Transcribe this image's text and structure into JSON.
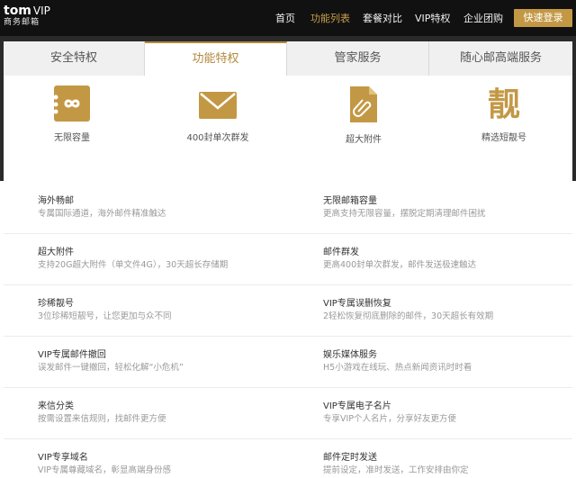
{
  "brand": {
    "name": "tom",
    "vip": "VIP",
    "subtitle": "商务邮箱"
  },
  "nav": {
    "items": [
      "首页",
      "功能列表",
      "套餐对比",
      "VIP特权",
      "企业团购"
    ],
    "active_index": 1,
    "login_label": "快速登录"
  },
  "tabs": [
    "安全特权",
    "功能特权",
    "管家服务",
    "随心邮高端服务"
  ],
  "active_tab": 1,
  "features": [
    {
      "label": "无限容量",
      "icon": "infinity-icon"
    },
    {
      "label": "400封单次群发",
      "icon": "envelope-icon"
    },
    {
      "label": "超大附件",
      "icon": "paperclip-icon"
    },
    {
      "label": "精选短靓号",
      "icon": "liang-character-icon"
    }
  ],
  "rows": [
    {
      "left": {
        "title": "海外畅邮",
        "desc": "专属国际通道，海外邮件精准触达"
      },
      "right": {
        "title": "无限邮箱容量",
        "desc": "更高支持无限容量，摆脱定期清理邮件困扰"
      }
    },
    {
      "left": {
        "title": "超大附件",
        "desc": "支持20G超大附件（单文件4G），30天超长存储期"
      },
      "right": {
        "title": "邮件群发",
        "desc": "更高400封单次群发，邮件发送极速触达"
      }
    },
    {
      "left": {
        "title": "珍稀靓号",
        "desc": "3位珍稀短靓号，让您更加与众不同"
      },
      "right": {
        "title": "VIP专属误删恢复",
        "desc": "2轻松恢复彻底删除的邮件，30天超长有效期"
      }
    },
    {
      "left": {
        "title": "VIP专属邮件撤回",
        "desc": "误发邮件一键撤回，轻松化解“小危机”"
      },
      "right": {
        "title": "娱乐媒体服务",
        "desc": "H5小游戏在线玩、热点新闻资讯时时看"
      }
    },
    {
      "left": {
        "title": "来信分类",
        "desc": "按需设置来信规则，找邮件更方便"
      },
      "right": {
        "title": "VIP专属电子名片",
        "desc": "专享VIP个人名片，分享好友更方便"
      }
    },
    {
      "left": {
        "title": "VIP专享域名",
        "desc": "VIP专属尊藏域名，彰显高端身份感"
      },
      "right": {
        "title": "邮件定时发送",
        "desc": "提前设定，准时发送，工作安排由你定"
      }
    }
  ],
  "colors": {
    "accent": "#c39845",
    "nav_bg": "#111111",
    "tab_active_text": "#b28a3e"
  }
}
